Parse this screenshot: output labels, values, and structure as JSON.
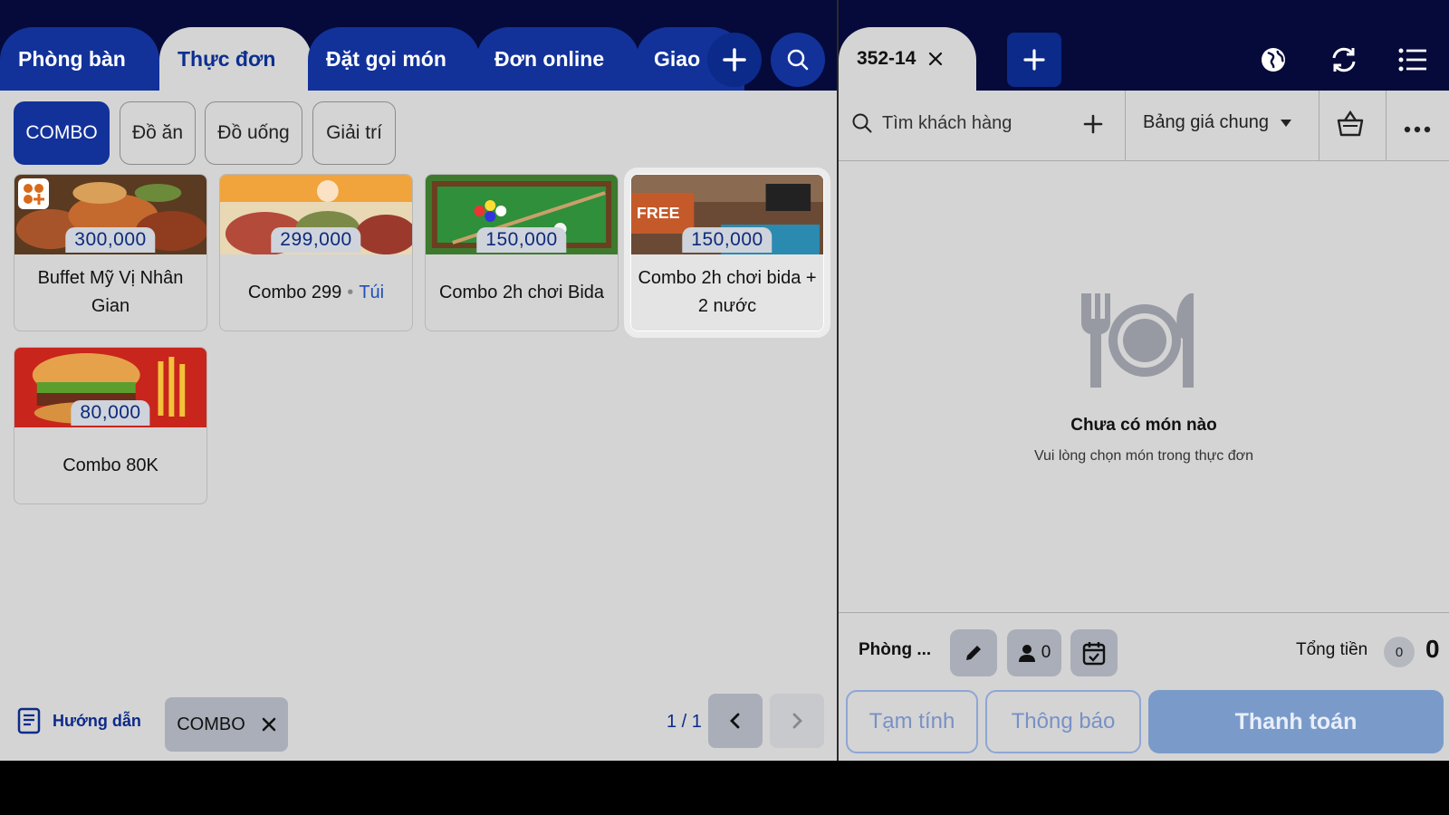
{
  "tabs": [
    {
      "label": "Phòng bàn",
      "active": false
    },
    {
      "label": "Thực đơn",
      "active": true
    },
    {
      "label": "Đặt gọi món",
      "active": false
    },
    {
      "label": "Đơn online",
      "active": false
    },
    {
      "label": "Giao",
      "active": false
    }
  ],
  "categories": [
    {
      "label": "COMBO",
      "active": true
    },
    {
      "label": "Đồ ăn",
      "active": false
    },
    {
      "label": "Đồ uống",
      "active": false
    },
    {
      "label": "Giải trí",
      "active": false
    }
  ],
  "products": [
    {
      "price": "300,000",
      "name": "Buffet Mỹ Vị Nhân Gian",
      "unit": "",
      "icon": "combo-icon"
    },
    {
      "price": "299,000",
      "name": "Combo 299",
      "unit": "Túi"
    },
    {
      "price": "150,000",
      "name": "Combo 2h chơi Bida",
      "unit": ""
    },
    {
      "price": "150,000",
      "name": "Combo 2h chơi bida + 2 nước",
      "unit": "",
      "selected": true
    },
    {
      "price": "80,000",
      "name": "Combo 80K",
      "unit": ""
    }
  ],
  "footer_left": {
    "guide_label": "Hướng dẫn",
    "filter_chip": "COMBO",
    "pager": "1 / 1"
  },
  "order": {
    "tab_label": "352-14",
    "customer_placeholder": "Tìm khách hàng",
    "price_list": "Bảng giá chung",
    "empty_title": "Chưa có món nào",
    "empty_subtitle": "Vui lòng chọn món trong thực đơn",
    "room_label": "Phòng ...",
    "guest_count": "0",
    "total_label": "Tổng tiền",
    "total_qty": "0",
    "total_value": "0",
    "btn_provisional": "Tạm tính",
    "btn_notify": "Thông báo",
    "btn_pay": "Thanh toán"
  },
  "colors": {
    "topbar": "#050a3a",
    "accent": "#12329a",
    "panel_bg": "#d4d4d4"
  }
}
